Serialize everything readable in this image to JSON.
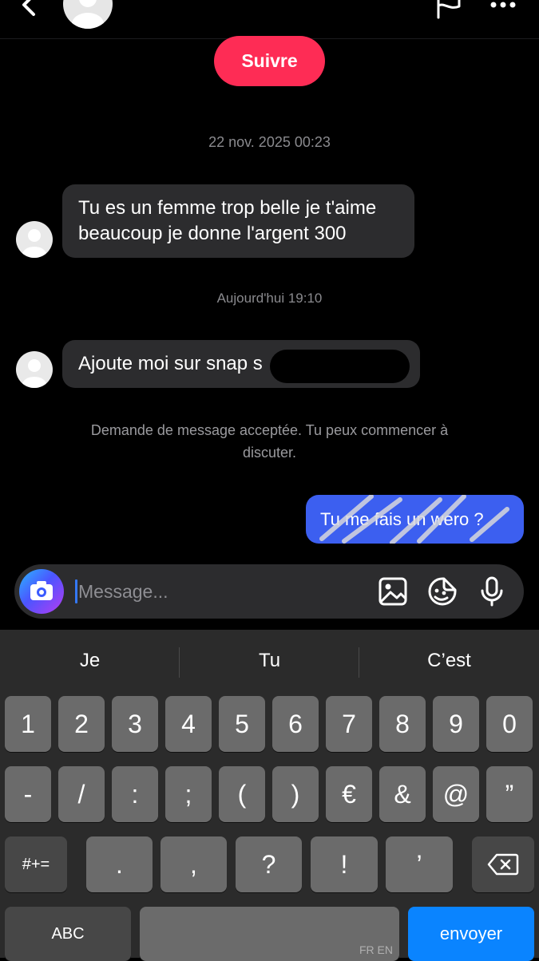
{
  "header": {
    "back_icon": "chevron-left-icon",
    "avatar_icon": "default-avatar-icon",
    "flag_icon": "flag-icon",
    "more_icon": "more-dots-icon"
  },
  "follow_button": "Suivre",
  "conversation": {
    "timestamp_1": "22 nov. 2025 00:23",
    "message_1_line1": "Tu es un femme trop belle je t'aime",
    "message_1_line2": "beaucoup je donne l'argent 300",
    "timestamp_2": "Aujourd'hui 19:10",
    "message_2": "Ajoute moi sur snap s",
    "notice_line1": "Demande de message acceptée. Tu peux commencer à",
    "notice_line2": "discuter.",
    "sent_message": "Tu me fais un wero ?"
  },
  "composer": {
    "placeholder": "Message...",
    "camera_icon": "camera-icon",
    "image_icon": "image-icon",
    "sticker_icon": "sticker-icon",
    "mic_icon": "microphone-icon"
  },
  "keyboard": {
    "suggestions": [
      "Je",
      "Tu",
      "C’est"
    ],
    "row1": [
      "1",
      "2",
      "3",
      "4",
      "5",
      "6",
      "7",
      "8",
      "9",
      "0"
    ],
    "row2": [
      "-",
      "/",
      ":",
      ";",
      "(",
      ")",
      "€",
      "&",
      "@",
      "”"
    ],
    "row3_left": "#+=",
    "row3": [
      ".",
      ",",
      "?",
      "!",
      "’"
    ],
    "backspace_icon": "backspace-icon",
    "abc": "ABC",
    "lang": "FR EN",
    "send": "envoyer"
  },
  "colors": {
    "follow": "#fe2c55",
    "sent_bubble": "#3c5ff0",
    "send_key": "#0a84ff"
  }
}
